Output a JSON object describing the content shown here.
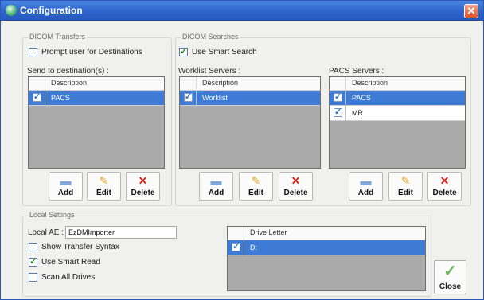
{
  "window": {
    "title": "Configuration",
    "close_glyph": "✕"
  },
  "dicom_transfers": {
    "group_title": "DICOM Transfers",
    "prompt_label": "Prompt user for Destinations",
    "prompt_checked": false,
    "send_to_label": "Send to destination(s) :",
    "list_header": "Description",
    "rows": [
      {
        "text": "PACS",
        "checked": true,
        "selected": true
      }
    ]
  },
  "dicom_searches": {
    "group_title": "DICOM Searches",
    "smart_search_label": "Use Smart Search",
    "smart_search_checked": true,
    "worklist_label": "Worklist Servers :",
    "worklist_header": "Description",
    "worklist_rows": [
      {
        "text": "Worklist",
        "checked": true,
        "selected": true
      }
    ],
    "pacs_label": "PACS Servers :",
    "pacs_header": "Description",
    "pacs_rows": [
      {
        "text": "PACS",
        "checked": true,
        "selected": true
      },
      {
        "text": "MR",
        "checked": true,
        "selected": false
      }
    ]
  },
  "buttons": {
    "add": "Add",
    "edit": "Edit",
    "delete": "Delete"
  },
  "icons": {
    "add": "printer-icon",
    "edit": "pencil-icon",
    "delete": "x-delete-icon"
  },
  "local_settings": {
    "group_title": "Local Settings",
    "local_ae_label": "Local AE :",
    "local_ae_value": "EzDMImporter",
    "show_syntax_label": "Show Transfer Syntax",
    "show_syntax_checked": false,
    "smart_read_label": "Use Smart Read",
    "smart_read_checked": true,
    "scan_drives_label": "Scan All Drives",
    "scan_drives_checked": false,
    "drive_header": "Drive Letter",
    "drive_rows": [
      {
        "text": "D:",
        "checked": true,
        "selected": true
      }
    ]
  },
  "close_button": {
    "label": "Close"
  },
  "colors": {
    "titlebar": "#2d63cc",
    "selection": "#3e7bd6",
    "list_background": "#aaaaaa"
  }
}
